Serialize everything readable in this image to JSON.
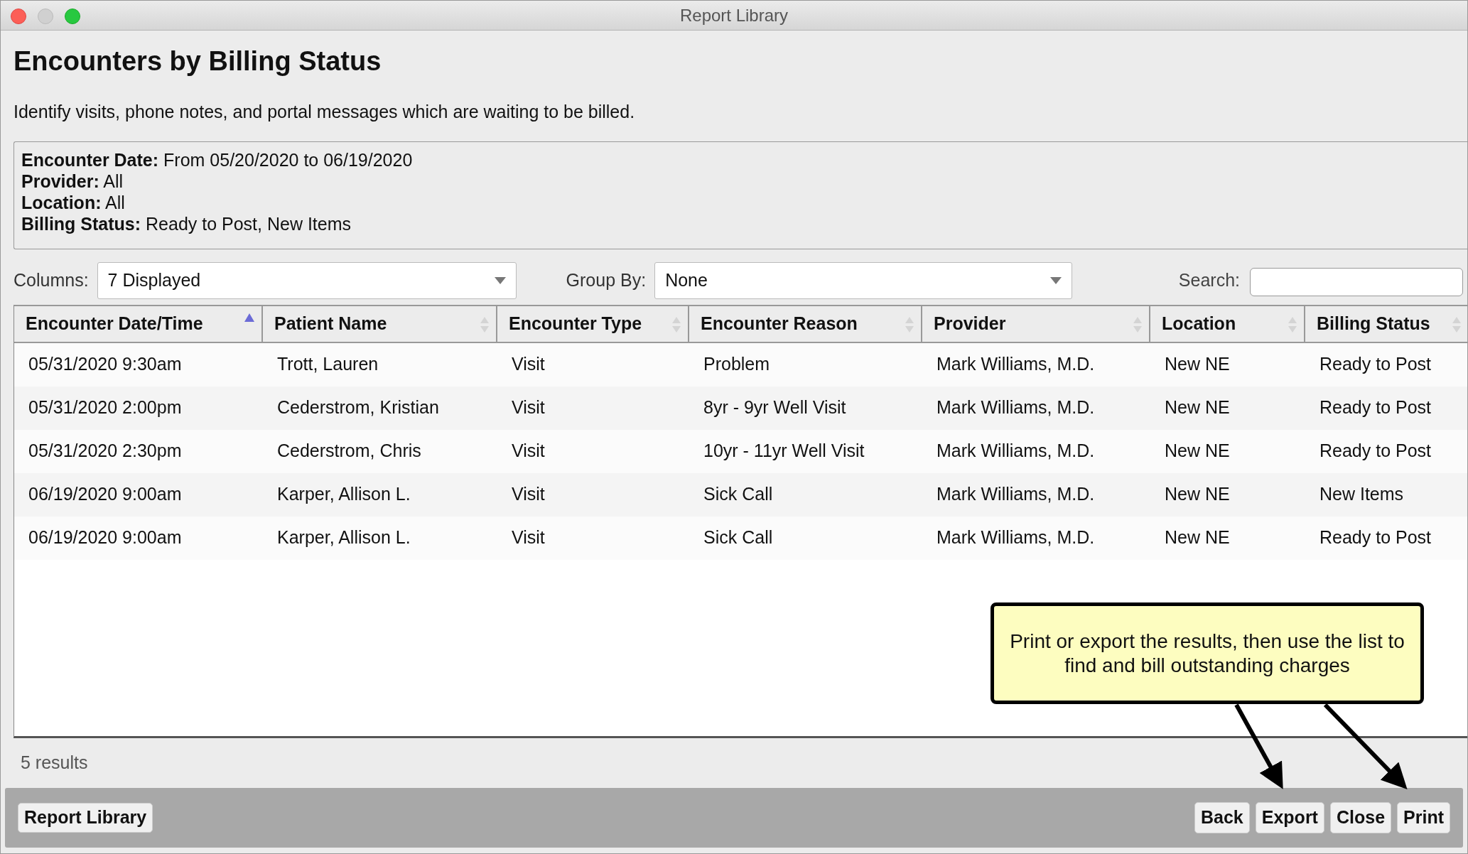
{
  "window": {
    "title": "Report Library"
  },
  "report": {
    "title": "Encounters by Billing Status",
    "description": "Identify visits, phone notes, and portal messages which are waiting to be billed."
  },
  "filters": [
    {
      "label": "Encounter Date:",
      "value": "From 05/20/2020 to 06/19/2020"
    },
    {
      "label": "Provider:",
      "value": "All"
    },
    {
      "label": "Location:",
      "value": "All"
    },
    {
      "label": "Billing Status:",
      "value": "Ready to Post, New Items"
    }
  ],
  "controls": {
    "columns": {
      "label": "Columns:",
      "value": "7 Displayed"
    },
    "group_by": {
      "label": "Group By:",
      "value": "None"
    },
    "search": {
      "label": "Search:"
    }
  },
  "table": {
    "columns": [
      {
        "label": "Encounter Date/Time",
        "sorted": true
      },
      {
        "label": "Patient Name",
        "sorted": false
      },
      {
        "label": "Encounter Type",
        "sorted": false
      },
      {
        "label": "Encounter Reason",
        "sorted": false
      },
      {
        "label": "Provider",
        "sorted": false
      },
      {
        "label": "Location",
        "sorted": false
      },
      {
        "label": "Billing Status",
        "sorted": false
      }
    ],
    "rows": [
      [
        "05/31/2020 9:30am",
        "Trott, Lauren",
        "Visit",
        "Problem",
        "Mark Williams, M.D.",
        "New NE",
        "Ready to Post"
      ],
      [
        "05/31/2020 2:00pm",
        "Cederstrom, Kristian",
        "Visit",
        "8yr - 9yr Well Visit",
        "Mark Williams, M.D.",
        "New NE",
        "Ready to Post"
      ],
      [
        "05/31/2020 2:30pm",
        "Cederstrom, Chris",
        "Visit",
        "10yr - 11yr Well Visit",
        "Mark Williams, M.D.",
        "New NE",
        "Ready to Post"
      ],
      [
        "06/19/2020 9:00am",
        "Karper, Allison L.",
        "Visit",
        "Sick Call",
        "Mark Williams, M.D.",
        "New NE",
        "New Items"
      ],
      [
        "06/19/2020 9:00am",
        "Karper, Allison L.",
        "Visit",
        "Sick Call",
        "Mark Williams, M.D.",
        "New NE",
        "Ready to Post"
      ]
    ]
  },
  "result_count": "5 results",
  "callout": "Print or export the results, then use the list to find and bill outstanding charges",
  "footer": {
    "left_buttons": [
      "Report Library"
    ],
    "right_buttons": [
      "Back",
      "Export",
      "Close",
      "Print"
    ]
  }
}
